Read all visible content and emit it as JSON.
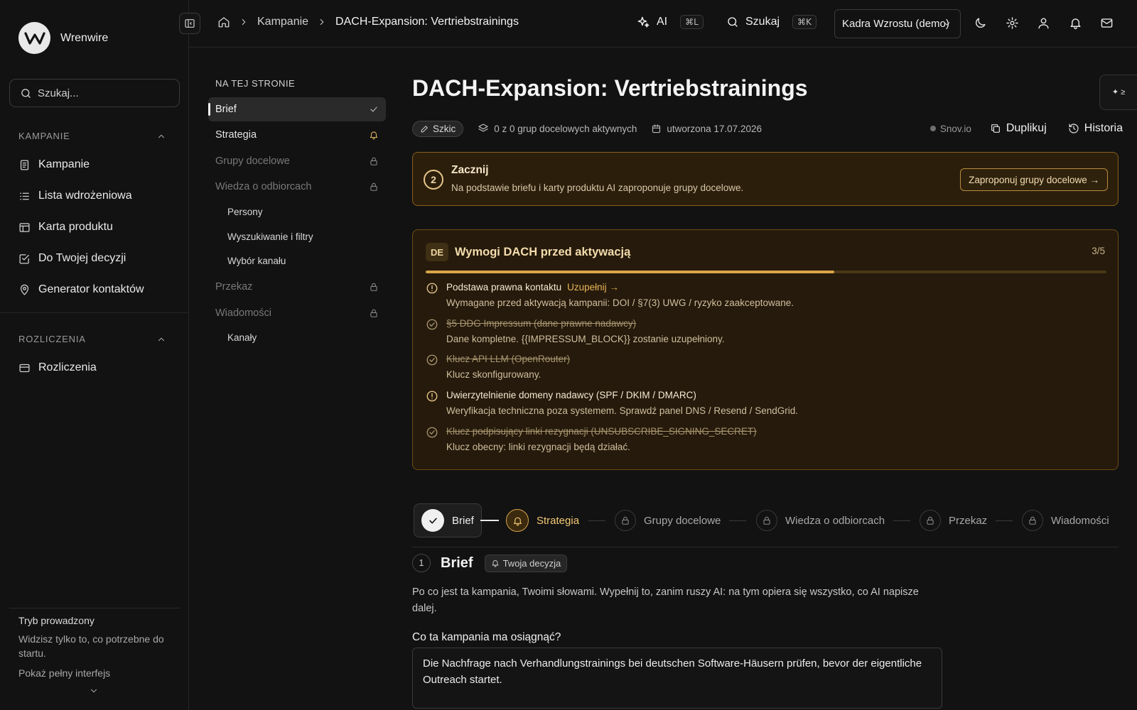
{
  "brand": {
    "name": "Wrenwire"
  },
  "sidebar": {
    "search_placeholder": "Szukaj...",
    "sections": [
      {
        "title": "KAMPANIE",
        "items": [
          {
            "label": "Kampanie",
            "icon": "document-icon"
          },
          {
            "label": "Lista wdrożeniowa",
            "icon": "list-icon"
          },
          {
            "label": "Karta produktu",
            "icon": "layout-icon"
          },
          {
            "label": "Do Twojej decyzji",
            "icon": "check-square-icon"
          },
          {
            "label": "Generator kontaktów",
            "icon": "map-pin-icon"
          }
        ]
      },
      {
        "title": "ROZLICZENIA",
        "items": [
          {
            "label": "Rozliczenia",
            "icon": "credit-card-icon"
          }
        ]
      }
    ],
    "guided": {
      "title": "Tryb prowadzony",
      "desc": "Widzisz tylko to, co potrzebne do startu.",
      "link": "Pokaż pełny interfejs"
    }
  },
  "topbar": {
    "breadcrumbs": [
      "Kampanie",
      "DACH-Expansion: Vertriebstrainings"
    ],
    "ai_label": "AI",
    "ai_shortcut": "⌘L",
    "search_label": "Szukaj",
    "search_shortcut": "⌘K",
    "workspace": "Kadra Wzrostu (demo)"
  },
  "toc": {
    "heading": "NA TEJ STRONIE",
    "items": [
      {
        "label": "Brief",
        "state": "active"
      },
      {
        "label": "Strategia",
        "state": "attention"
      },
      {
        "label": "Grupy docelowe",
        "state": "locked"
      },
      {
        "label": "Wiedza o odbiorcach",
        "state": "locked"
      },
      {
        "label": "Persony",
        "state": "sub"
      },
      {
        "label": "Wyszukiwanie i filtry",
        "state": "sub"
      },
      {
        "label": "Wybór kanału",
        "state": "sub"
      },
      {
        "label": "Przekaz",
        "state": "locked"
      },
      {
        "label": "Wiadomości",
        "state": "locked"
      },
      {
        "label": "Kanały",
        "state": "sub"
      }
    ]
  },
  "page": {
    "title": "DACH-Expansion: Vertriebstrainings",
    "status": "Szkic",
    "groups_active": "0 z 0 grup docelowych aktywnych",
    "created": "utworzona 17.07.2026",
    "source": "Snov.io",
    "duplicate": "Duplikuj",
    "history": "Historia"
  },
  "start_card": {
    "step": "2",
    "title": "Zacznij",
    "desc": "Na podstawie briefu i karty produktu AI zaproponuje grupy docelowe.",
    "button": "Zaproponuj grupy docelowe →"
  },
  "requirements": {
    "badge": "DE",
    "title": "Wymogi DACH przed aktywacją",
    "count": "3/5",
    "progress": 0.6,
    "items": [
      {
        "title": "Podstawa prawna kontaktu",
        "link": "Uzupełnij →",
        "desc": "Wymagane przed aktywacją kampanii: DOI / §7(3) UWG / ryzyko zaakceptowane.",
        "done": false
      },
      {
        "title": "§5 DDG Impressum (dane prawne nadawcy)",
        "link": "",
        "desc": "Dane kompletne. {{IMPRESSUM_BLOCK}} zostanie uzupełniony.",
        "done": true
      },
      {
        "title": "Klucz API LLM (OpenRouter)",
        "link": "",
        "desc": "Klucz skonfigurowany.",
        "done": true
      },
      {
        "title": "Uwierzytelnienie domeny nadawcy (SPF / DKIM / DMARC)",
        "link": "",
        "desc": "Weryfikacja techniczna poza systemem. Sprawdź panel DNS / Resend / SendGrid.",
        "done": false
      },
      {
        "title": "Klucz podpisujący linki rezygnacji (UNSUBSCRIBE_SIGNING_SECRET)",
        "link": "",
        "desc": "Klucz obecny: linki rezygnacji będą działać.",
        "done": true
      }
    ]
  },
  "stepper": [
    "Brief",
    "Strategia",
    "Grupy docelowe",
    "Wiedza o odbiorcach",
    "Przekaz",
    "Wiadomości"
  ],
  "brief": {
    "number": "1",
    "title": "Brief",
    "badge": "Twoja decyzja",
    "desc": "Po co jest ta kampania, Twoimi słowami. Wypełnij to, zanim ruszy AI: na tym opiera się wszystko, co AI napisze dalej.",
    "goal_label": "Co ta kampania ma osiągnąć?",
    "goal_value": "Die Nachfrage nach Verhandlungstrainings bei deutschen Software-Häusern prüfen, bevor der eigentliche Outreach startet."
  },
  "side_tool": {
    "glyph": "✦ ≥"
  }
}
